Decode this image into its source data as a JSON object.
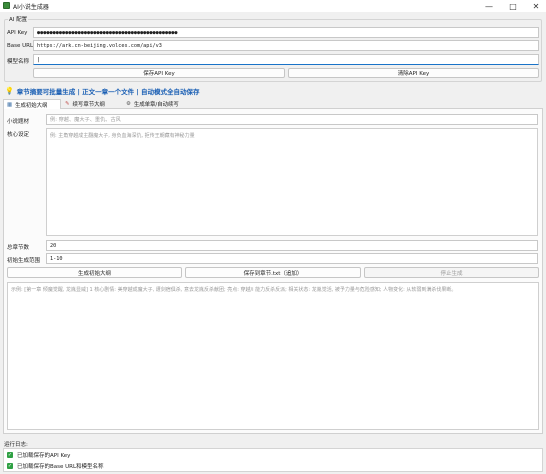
{
  "window": {
    "title": "AI小说生成器",
    "minimize_icon": "minimize-icon",
    "maximize_icon": "maximize-icon",
    "close_icon": "close-icon"
  },
  "ai_config": {
    "group_title": "AI 配置",
    "api_key_label": "API Key",
    "api_key_value": "●●●●●●●●●●●●●●●●●●●●●●●●●●●●●●●●●●●●●●●●●●●●●",
    "base_url_label": "Base URL",
    "base_url_value": "https://ark.cn-beijing.volces.com/api/v3",
    "model_label": "模型名称",
    "model_value": "",
    "save_key_button": "保存API Key",
    "clear_key_button": "清除API Key"
  },
  "notice": {
    "icon": "lightbulb-icon",
    "text": "章节摘要可批量生成 | 正文一章一个文件 | 自动模式全自动保存"
  },
  "tabs": [
    {
      "label": "生成初始大纲",
      "icon": "book-icon",
      "active": true
    },
    {
      "label": "续写章节大纲",
      "icon": "pencil-icon",
      "active": false
    },
    {
      "label": "生成单章/自动续写",
      "icon": "gear-icon",
      "active": false
    }
  ],
  "outline_form": {
    "theme_label": "小说题材",
    "theme_placeholder": "例: 穿越、魔大子、重仇、古风",
    "setting_label": "核心设定",
    "setting_placeholder": "例: 主角穿越成主翻魔大子, 身负血海深仇, 拒传王朝藏有神秘力量",
    "total_chapters_label": "总章节数",
    "total_chapters_value": "20",
    "range_label": "初始生成范围",
    "range_value": "1-10",
    "generate_button": "生成初始大纲",
    "save_button": "保存到章节.txt（追加）",
    "stop_button": "停止生成",
    "output_placeholder": "示例: [第一章 倾魔觉醒, 龙胤显威] 1 核心剧情: 美穿越成魔大子, 遭剑宿俱杀, 意去龙胤反杀献团; 亮点: 穿越/i 能力反杀反派; 相关状态: 龙胤觉活, 被予力量与危险感知; 人物变化: 从软弱到满杀伐果断。"
  },
  "log": {
    "label": "运行日志:",
    "entries": [
      {
        "icon": "check-icon",
        "text": "已加载保存的API Key"
      },
      {
        "icon": "check-icon",
        "text": "已加载保存的Base URL和模型名称"
      }
    ]
  }
}
